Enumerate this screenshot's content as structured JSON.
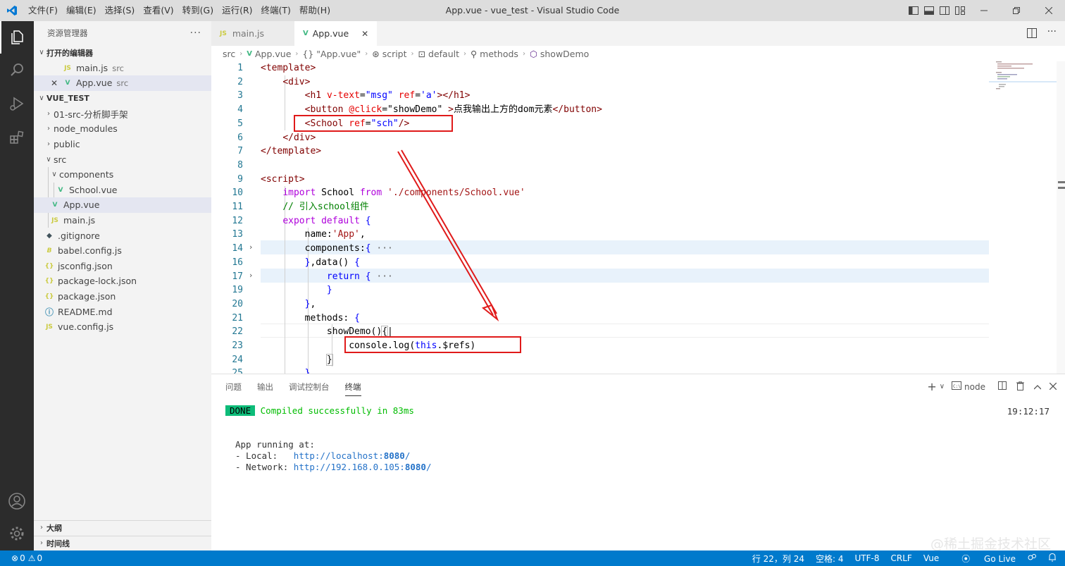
{
  "window": {
    "title": "App.vue - vue_test - Visual Studio Code",
    "menu": [
      "文件(F)",
      "编辑(E)",
      "选择(S)",
      "查看(V)",
      "转到(G)",
      "运行(R)",
      "终端(T)",
      "帮助(H)"
    ]
  },
  "sidebar": {
    "title": "资源管理器",
    "open_editors_label": "打开的编辑器",
    "open_editors": [
      {
        "icon": "JS",
        "name": "main.js",
        "desc": "src"
      },
      {
        "icon": "V",
        "name": "App.vue",
        "desc": "src"
      }
    ],
    "project_label": "VUE_TEST",
    "tree": [
      {
        "label": "01-src-分析脚手架",
        "icon": ""
      },
      {
        "label": "node_modules",
        "icon": ""
      },
      {
        "label": "public",
        "icon": ""
      },
      {
        "label": "src",
        "icon": ""
      },
      {
        "label": "components",
        "icon": ""
      },
      {
        "label": "School.vue",
        "icon": "V"
      },
      {
        "label": "App.vue",
        "icon": "V"
      },
      {
        "label": "main.js",
        "icon": "JS"
      },
      {
        "label": ".gitignore",
        "icon": "◆"
      },
      {
        "label": "babel.config.js",
        "icon": "B"
      },
      {
        "label": "jsconfig.json",
        "icon": "{}"
      },
      {
        "label": "package-lock.json",
        "icon": "{}"
      },
      {
        "label": "package.json",
        "icon": "{}"
      },
      {
        "label": "README.md",
        "icon": "ⓘ"
      },
      {
        "label": "vue.config.js",
        "icon": "JS"
      }
    ],
    "outline_label": "大纲",
    "timeline_label": "时间线"
  },
  "tabs": [
    {
      "label": "main.js",
      "icon": "JS"
    },
    {
      "label": "App.vue",
      "icon": "V"
    }
  ],
  "breadcrumbs": [
    "src",
    "App.vue",
    "{} \"App.vue\"",
    "script",
    "default",
    "methods",
    "showDemo"
  ],
  "editor": {
    "line_numbers": [
      "1",
      "2",
      "3",
      "4",
      "5",
      "6",
      "7",
      "8",
      "9",
      "10",
      "11",
      "12",
      "13",
      "14",
      "16",
      "17",
      "19",
      "20",
      "21",
      "22",
      "23",
      "24",
      "25"
    ]
  },
  "panel": {
    "tabs": [
      "问题",
      "输出",
      "调试控制台",
      "终端"
    ],
    "terminal_name": "node",
    "done_badge": "DONE",
    "compiled_msg": "Compiled successfully in 83ms",
    "time": "19:12:17",
    "running_label": "App running at:",
    "local_label": "- Local:   ",
    "local_url_a": "http://localhost:",
    "local_port": "8080",
    "local_url_b": "/",
    "network_label": "- Network: ",
    "network_url_a": "http://192.168.0.105:",
    "network_port": "8080",
    "network_url_b": "/"
  },
  "statusbar": {
    "errors": "0",
    "warnings": "0",
    "position": "行 22，列 24",
    "spaces": "空格: 4",
    "encoding": "UTF-8",
    "eol": "CRLF",
    "language": "Vue",
    "golive": "Go Live"
  },
  "watermark": "@稀土掘金技术社区",
  "colors": {
    "accent": "#007acc",
    "annotation_red": "#e01a1a"
  }
}
